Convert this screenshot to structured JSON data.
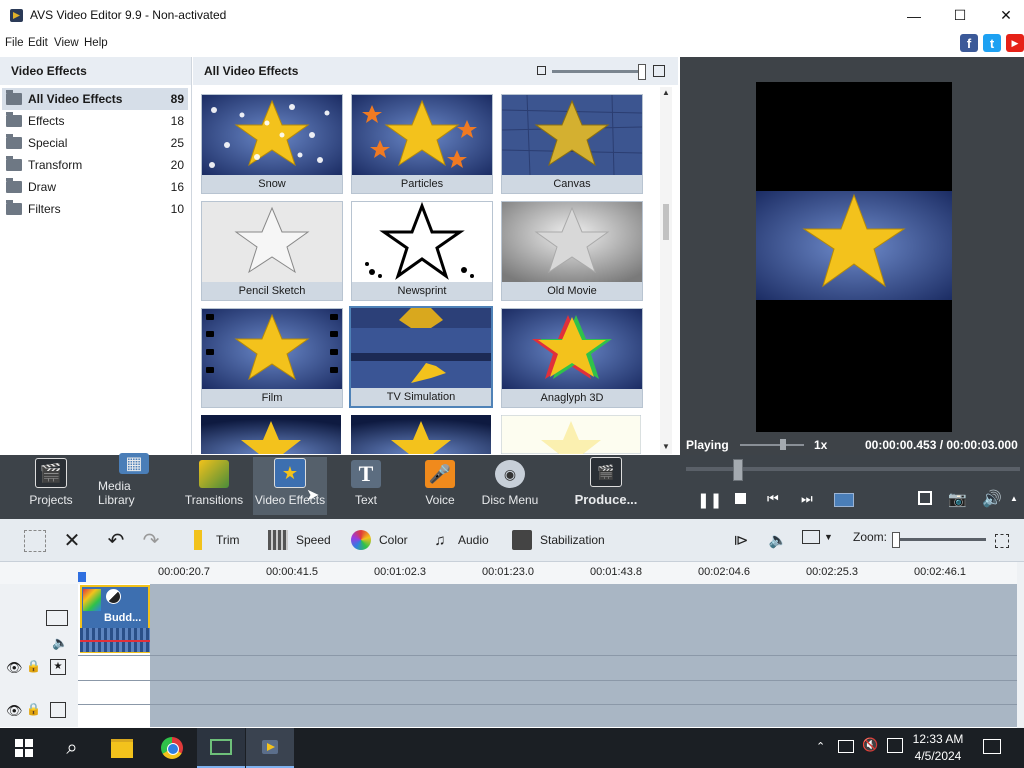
{
  "window": {
    "title": "AVS Video Editor 9.9 - Non-activated",
    "minimize": "—",
    "maximize": "☐",
    "close": "✕"
  },
  "menu": [
    "File",
    "Edit",
    "View",
    "Help"
  ],
  "social": {
    "facebook": "f",
    "twitter": "t",
    "youtube": "▶"
  },
  "categories": {
    "header": "Video Effects",
    "items": [
      {
        "label": "All Video Effects",
        "count": "89"
      },
      {
        "label": "Effects",
        "count": "18"
      },
      {
        "label": "Special",
        "count": "25"
      },
      {
        "label": "Transform",
        "count": "20"
      },
      {
        "label": "Draw",
        "count": "16"
      },
      {
        "label": "Filters",
        "count": "10"
      }
    ]
  },
  "gallery": {
    "header": "All Video Effects",
    "selected_index": 7,
    "tiles": [
      {
        "label": "Snow"
      },
      {
        "label": "Particles"
      },
      {
        "label": "Canvas"
      },
      {
        "label": "Pencil Sketch"
      },
      {
        "label": "Newsprint"
      },
      {
        "label": "Old Movie"
      },
      {
        "label": "Film"
      },
      {
        "label": "TV Simulation"
      },
      {
        "label": "Anaglyph 3D"
      }
    ]
  },
  "preview": {
    "status": "Playing",
    "speed": "1x",
    "time": "00:00:00.453 / 00:00:03.000"
  },
  "toolbar": [
    {
      "label": "Projects",
      "icon": "clapper-icon"
    },
    {
      "label": "Media Library",
      "icon": "film-icon"
    },
    {
      "label": "Transitions",
      "icon": "transitions-icon"
    },
    {
      "label": "Video Effects",
      "icon": "star-icon"
    },
    {
      "label": "Text",
      "icon": "text-icon"
    },
    {
      "label": "Voice",
      "icon": "microphone-icon"
    },
    {
      "label": "Disc Menu",
      "icon": "disc-icon"
    },
    {
      "label": "Produce...",
      "icon": "produce-icon"
    }
  ],
  "edit_tools": {
    "trim": "Trim",
    "speed": "Speed",
    "color": "Color",
    "audio": "Audio",
    "stabilization": "Stabilization",
    "zoom": "Zoom:"
  },
  "timeline": {
    "ticks": [
      "00:00:20.7",
      "00:00:41.5",
      "00:01:02.3",
      "00:01:23.0",
      "00:01:43.8",
      "00:02:04.6",
      "00:02:25.3",
      "00:02:46.1"
    ],
    "clip_label": "Budd..."
  },
  "taskbar": {
    "time": "12:33 AM",
    "date": "4/5/2024"
  }
}
